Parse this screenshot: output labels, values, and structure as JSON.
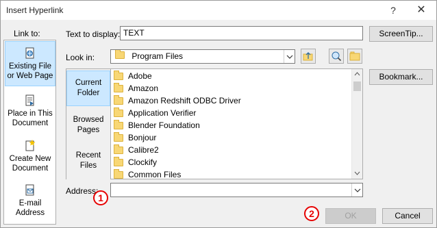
{
  "window": {
    "title": "Insert Hyperlink",
    "help": "?",
    "close": "✕"
  },
  "link_to": {
    "label": "Link to:",
    "items": [
      {
        "line1": "Existing File",
        "line2": "or Web Page"
      },
      {
        "line1": "Place in This",
        "line2": "Document"
      },
      {
        "line1": "Create New",
        "line2": "Document"
      },
      {
        "line1": "E-mail",
        "line2": "Address"
      }
    ]
  },
  "text_to_display": {
    "label": "Text to display:",
    "value": "TEXT"
  },
  "screentip_button": "ScreenTip...",
  "look_in": {
    "label": "Look in:",
    "value": "Program Files"
  },
  "bookmark_button": "Bookmark...",
  "nav": [
    {
      "line1": "Current",
      "line2": "Folder"
    },
    {
      "line1": "Browsed",
      "line2": "Pages"
    },
    {
      "line1": "Recent",
      "line2": "Files"
    }
  ],
  "files": [
    "Adobe",
    "Amazon",
    "Amazon Redshift ODBC Driver",
    "Application Verifier",
    "Blender Foundation",
    "Bonjour",
    "Calibre2",
    "Clockify",
    "Common Files"
  ],
  "address": {
    "label": "Address:",
    "value": ""
  },
  "ok_button": "OK",
  "cancel_button": "Cancel",
  "markers": {
    "one": "1",
    "two": "2"
  },
  "colors": {
    "selected_bg": "#cce8ff",
    "marker": "#e60000",
    "folder": "#f8d775"
  }
}
